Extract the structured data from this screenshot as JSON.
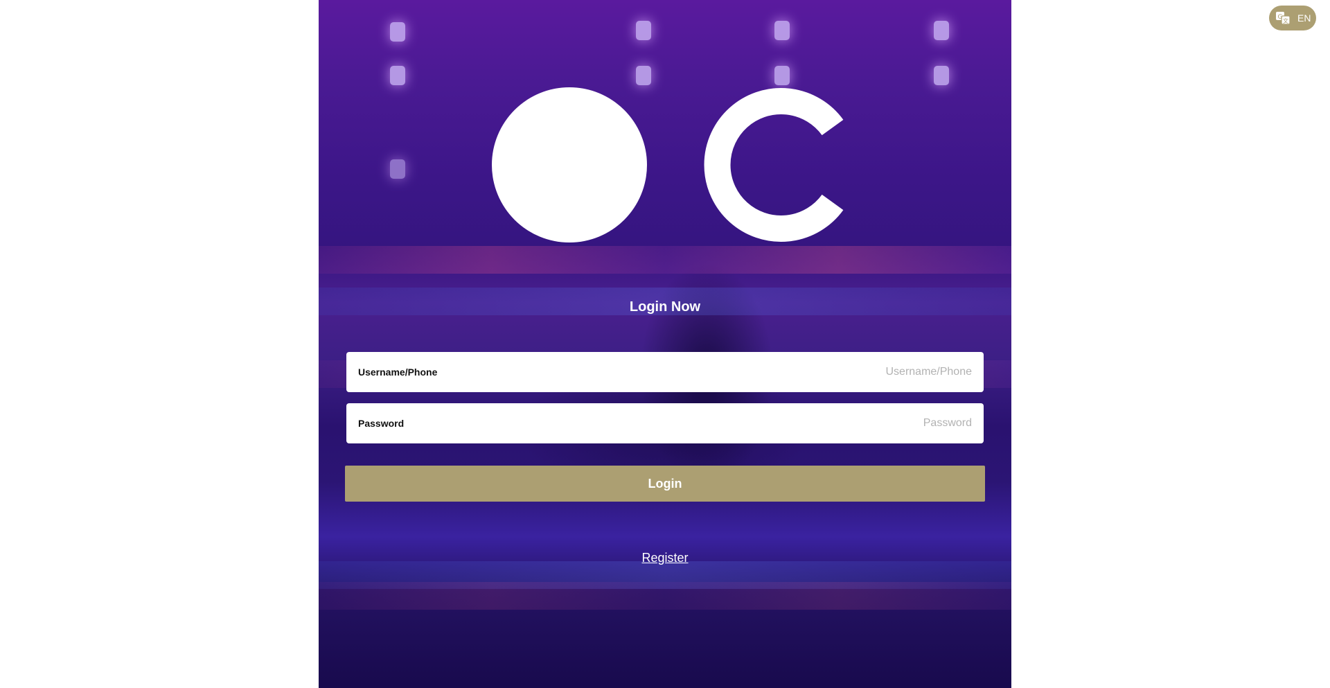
{
  "language": {
    "current": "EN",
    "icon": "translate-icon"
  },
  "logo": {
    "icon": "brand-logo-icon"
  },
  "login": {
    "title": "Login Now",
    "username": {
      "label": "Username/Phone",
      "placeholder": "Username/Phone",
      "value": ""
    },
    "password": {
      "label": "Password",
      "placeholder": "Password",
      "value": ""
    },
    "submit_label": "Login",
    "register_label": "Register"
  },
  "colors": {
    "accent": "#ac9f72",
    "panel_top": "#5a1a9e",
    "panel_bottom": "#180a4d",
    "text_light": "#ffffff",
    "placeholder": "#b2b2b2"
  }
}
